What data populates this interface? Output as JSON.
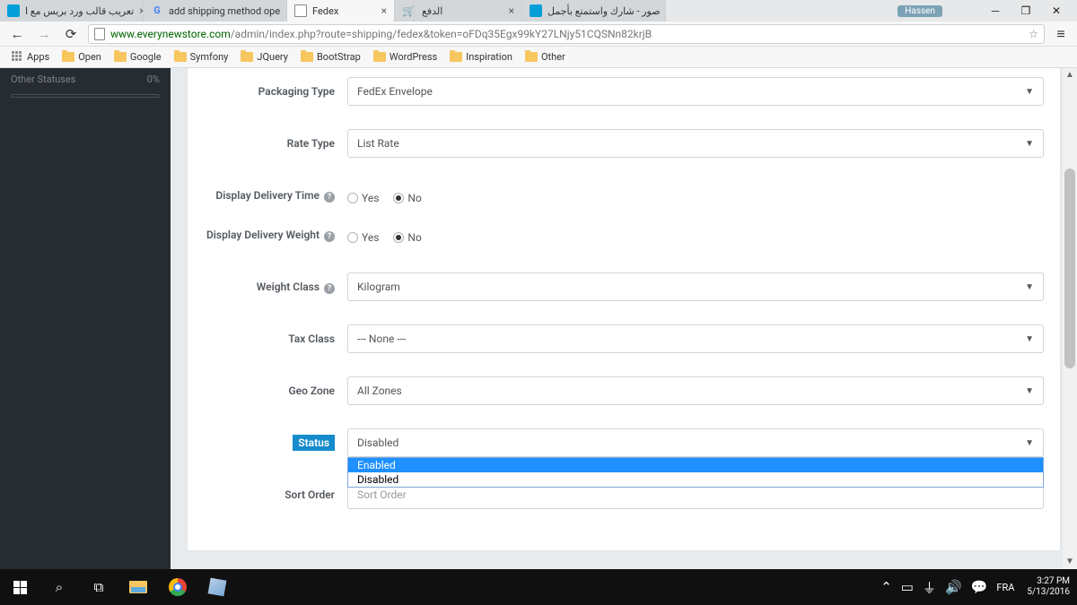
{
  "browser": {
    "tabs": [
      {
        "title": "تعريب قالب ورد بريس مع ا"
      },
      {
        "title": "add shipping method ope"
      },
      {
        "title": "Fedex"
      },
      {
        "title": ""
      },
      {
        "title": "الدفع"
      },
      {
        "title": "صور - شارك واستمتع بأجمل"
      }
    ],
    "user": "Hassen",
    "url_domain": "www.everynewstore.com",
    "url_path": "/admin/index.php?route=shipping/fedex&token=oFDq35Egx99kY27LNjy51CQSNn82krjB",
    "bookmarks": [
      "Apps",
      "Open",
      "Google",
      "Symfony",
      "JQuery",
      "BootStrap",
      "WordPress",
      "Inspiration",
      "Other"
    ]
  },
  "sidebar": {
    "row_label": "Other Statuses",
    "row_value": "0%"
  },
  "form": {
    "packaging_type": {
      "label": "Packaging Type",
      "value": "FedEx Envelope"
    },
    "rate_type": {
      "label": "Rate Type",
      "value": "List Rate"
    },
    "display_time": {
      "label": "Display Delivery Time",
      "yes": "Yes",
      "no": "No"
    },
    "display_weight": {
      "label": "Display Delivery Weight",
      "yes": "Yes",
      "no": "No"
    },
    "weight_class": {
      "label": "Weight Class",
      "value": "Kilogram"
    },
    "tax_class": {
      "label": "Tax Class",
      "value": "--- None ---"
    },
    "geo_zone": {
      "label": "Geo Zone",
      "value": "All Zones"
    },
    "status": {
      "label": "Status",
      "value": "Disabled",
      "options": [
        "Enabled",
        "Disabled"
      ]
    },
    "sort_order": {
      "label": "Sort Order",
      "placeholder": "Sort Order"
    }
  },
  "taskbar": {
    "lang": "FRA",
    "time": "3:27 PM",
    "date": "5/13/2016"
  }
}
